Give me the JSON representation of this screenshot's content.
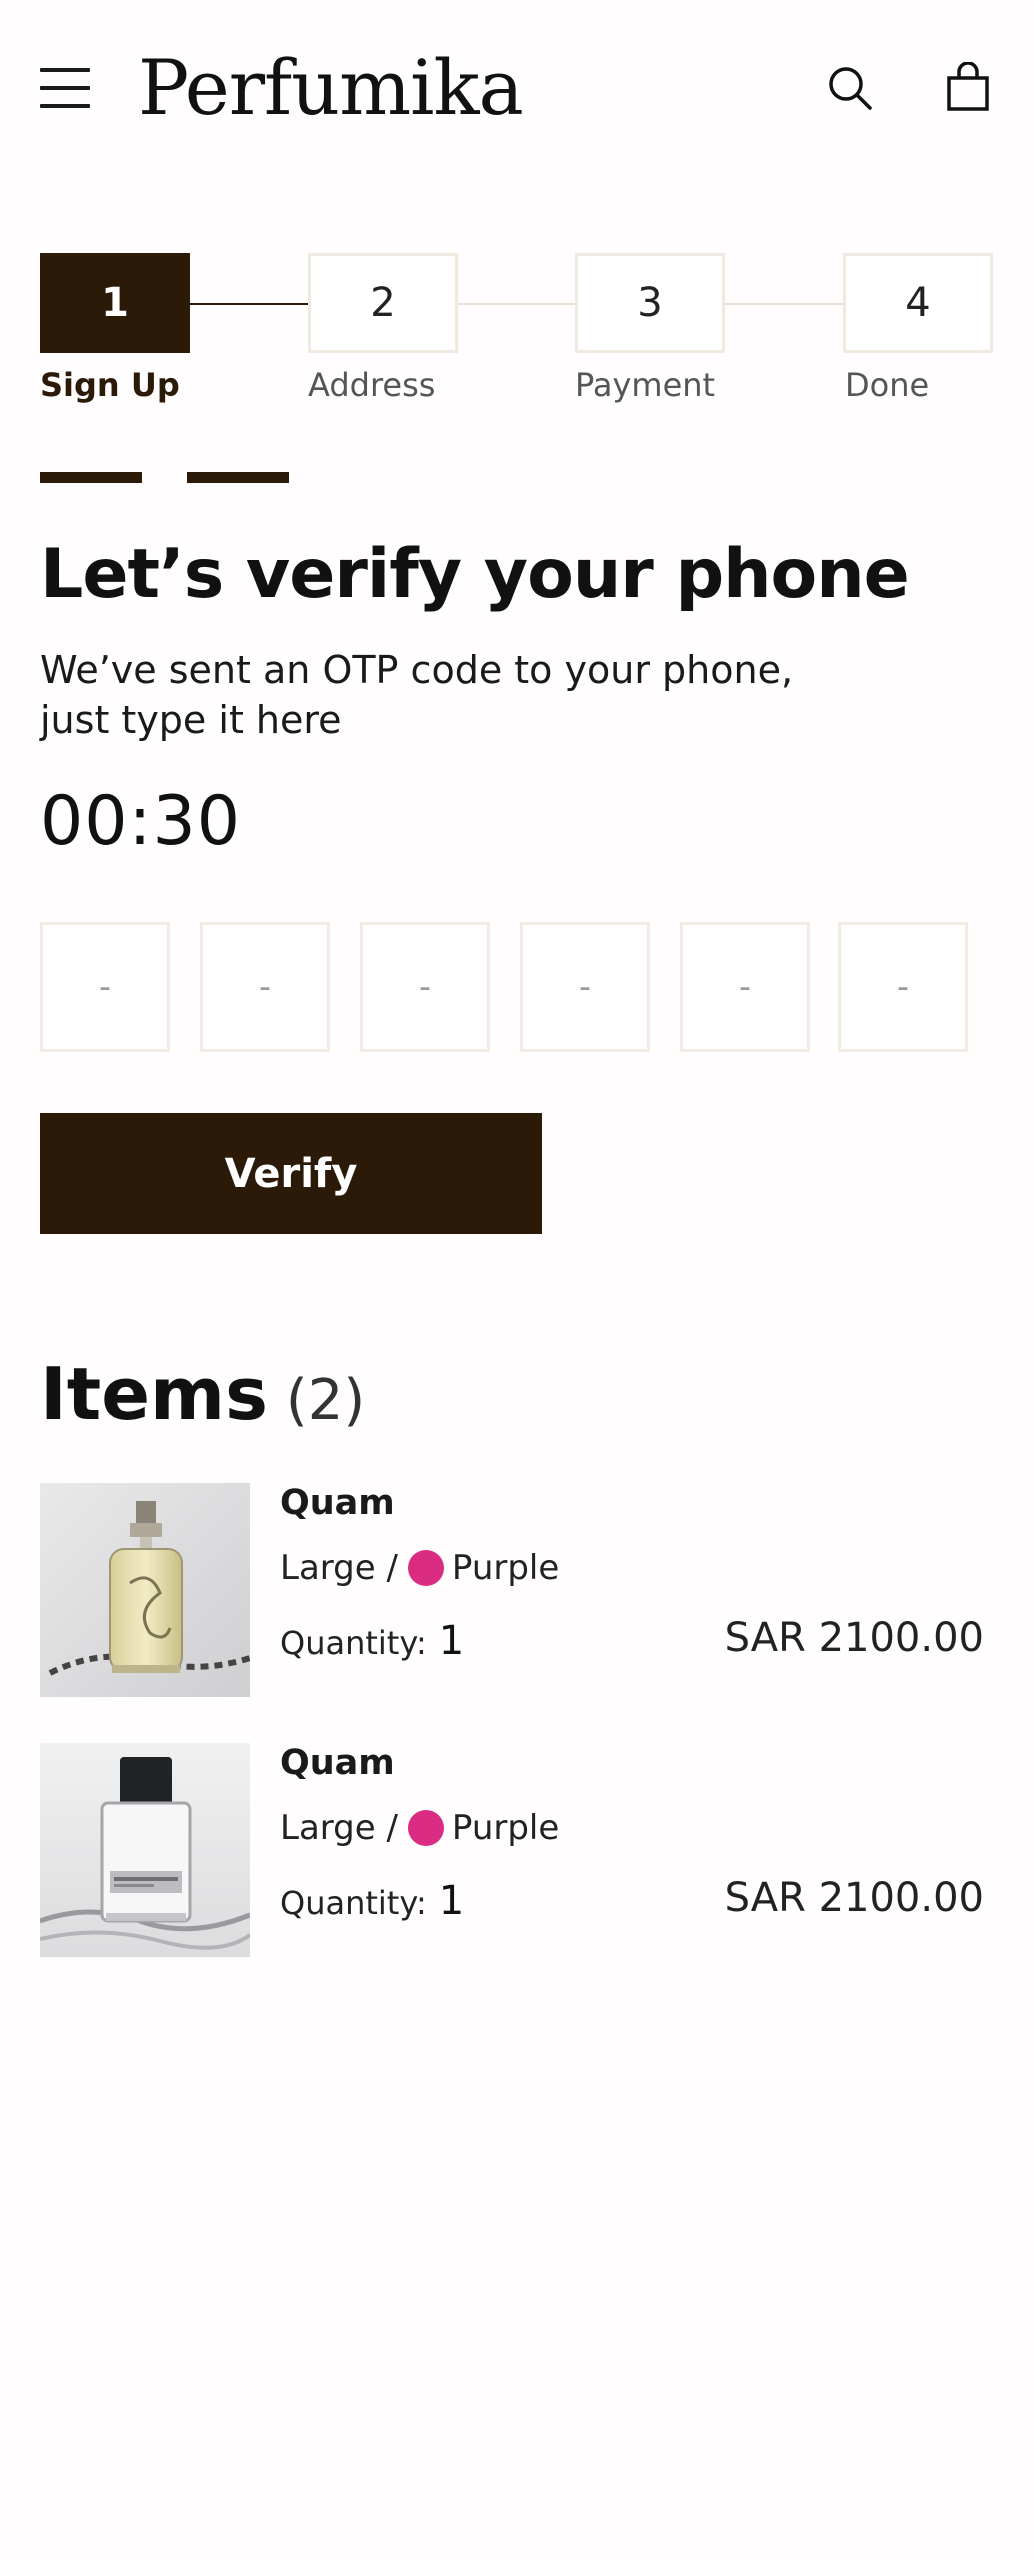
{
  "header": {
    "brand": "Perfumika",
    "menu_icon": "hamburger-menu-icon",
    "search_icon": "search-icon",
    "cart_icon": "shopping-bag-icon"
  },
  "stepper": {
    "steps": [
      {
        "number": "1",
        "label": "Sign Up",
        "active": true
      },
      {
        "number": "2",
        "label": "Address",
        "active": false
      },
      {
        "number": "3",
        "label": "Payment",
        "active": false
      },
      {
        "number": "4",
        "label": "Done",
        "active": false
      }
    ]
  },
  "verify": {
    "title": "Let’s verify your phone",
    "subtitle_line1": "We’ve sent an OTP code to your phone,",
    "subtitle_line2": "just type it here",
    "timer": "00:30",
    "otp_placeholders": [
      "-",
      "-",
      "-",
      "-",
      "-",
      "-"
    ],
    "button_label": "Verify"
  },
  "items": {
    "title": "Items",
    "count": "(2)",
    "list": [
      {
        "name": "Quam",
        "size": "Large /",
        "color_name": "Purple",
        "color_hex": "#d92c82",
        "quantity_label": "Quantity:",
        "quantity": "1",
        "price": "SAR 2100.00"
      },
      {
        "name": "Quam",
        "size": "Large /",
        "color_name": "Purple",
        "color_hex": "#d92c82",
        "quantity_label": "Quantity:",
        "quantity": "1",
        "price": "SAR 2100.00"
      }
    ]
  },
  "colors": {
    "primary_dark": "#2b1a08",
    "box_border": "#efeae0"
  }
}
